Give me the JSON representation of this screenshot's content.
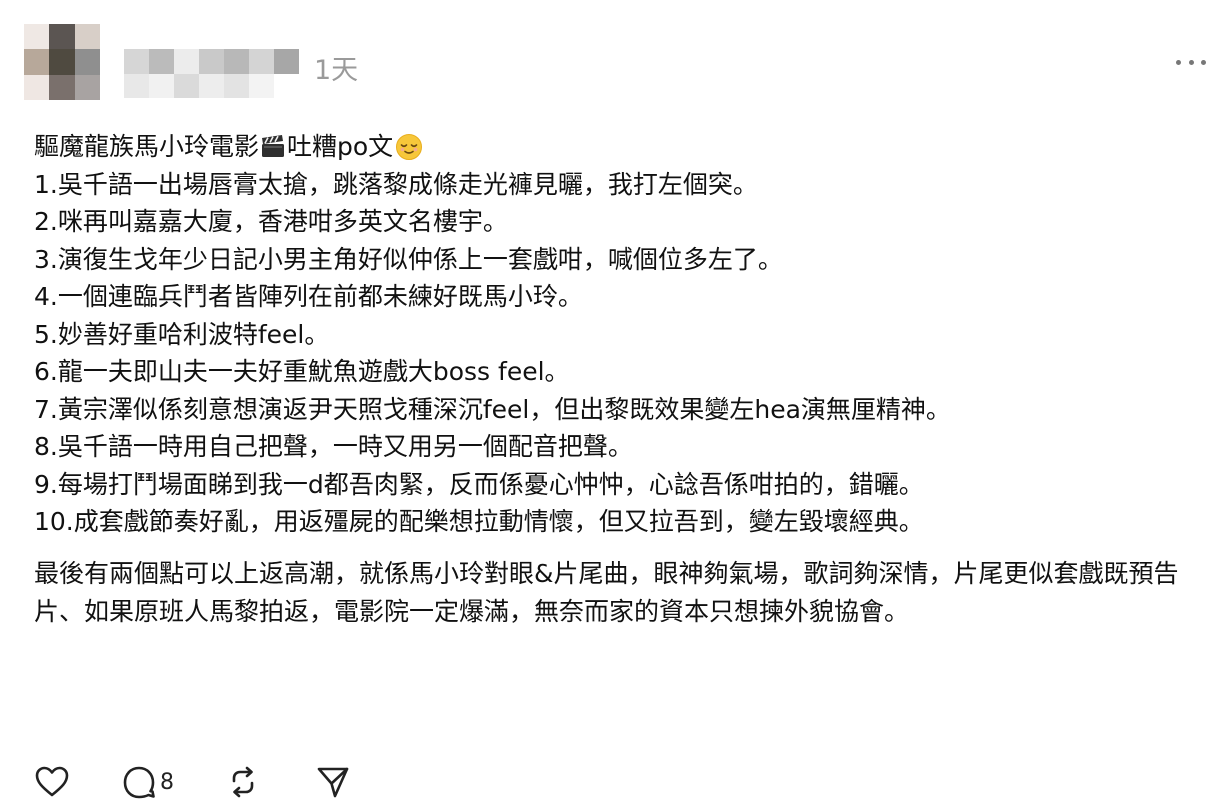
{
  "post": {
    "timestamp": "1天",
    "title_prefix": "驅魔龍族馬小玲電影",
    "title_icon": "clapper-board-icon",
    "title_suffix": "吐糟po文",
    "title_emoji": "relieved-face-icon",
    "points": [
      "1.吳千語一出場唇膏太搶，跳落黎成條走光褲見曬，我打左個突。",
      "2.咪再叫嘉嘉大廈，香港咁多英文名樓宇。",
      "3.演復生戈年少日記小男主角好似仲係上一套戲咁，喊個位多左了。",
      "4.一個連臨兵鬥者皆陣列在前都未練好既馬小玲。",
      "5.妙善好重哈利波特feel。",
      "6.龍一夫即山夫一夫好重魷魚遊戲大boss feel。",
      "7.黃宗澤似係刻意想演返尹天照戈種深沉feel，但出黎既效果變左hea演無厘精神。",
      "8.吳千語一時用自己把聲，一時又用另一個配音把聲。",
      "9.每場打鬥場面睇到我一d都吾肉緊，反而係憂心忡忡，心諗吾係咁拍的，錯曬。",
      "10.成套戲節奏好亂，用返殭屍的配樂想拉動情懷，但又拉吾到，變左毀壞經典。"
    ],
    "closing": "最後有兩個點可以上返高潮，就係馬小玲對眼&片尾曲，眼神夠氣場，歌詞夠深情，片尾更似套戲既預告片、如果原班人馬黎拍返，電影院一定爆滿，無奈而家的資本只想揀外貌協會。"
  },
  "actions": {
    "like_icon": "heart-icon",
    "comment_icon": "comment-bubble-icon",
    "comment_count": "8",
    "repost_icon": "repost-icon",
    "share_icon": "send-icon"
  },
  "menu_icon": "more-horizontal-icon"
}
